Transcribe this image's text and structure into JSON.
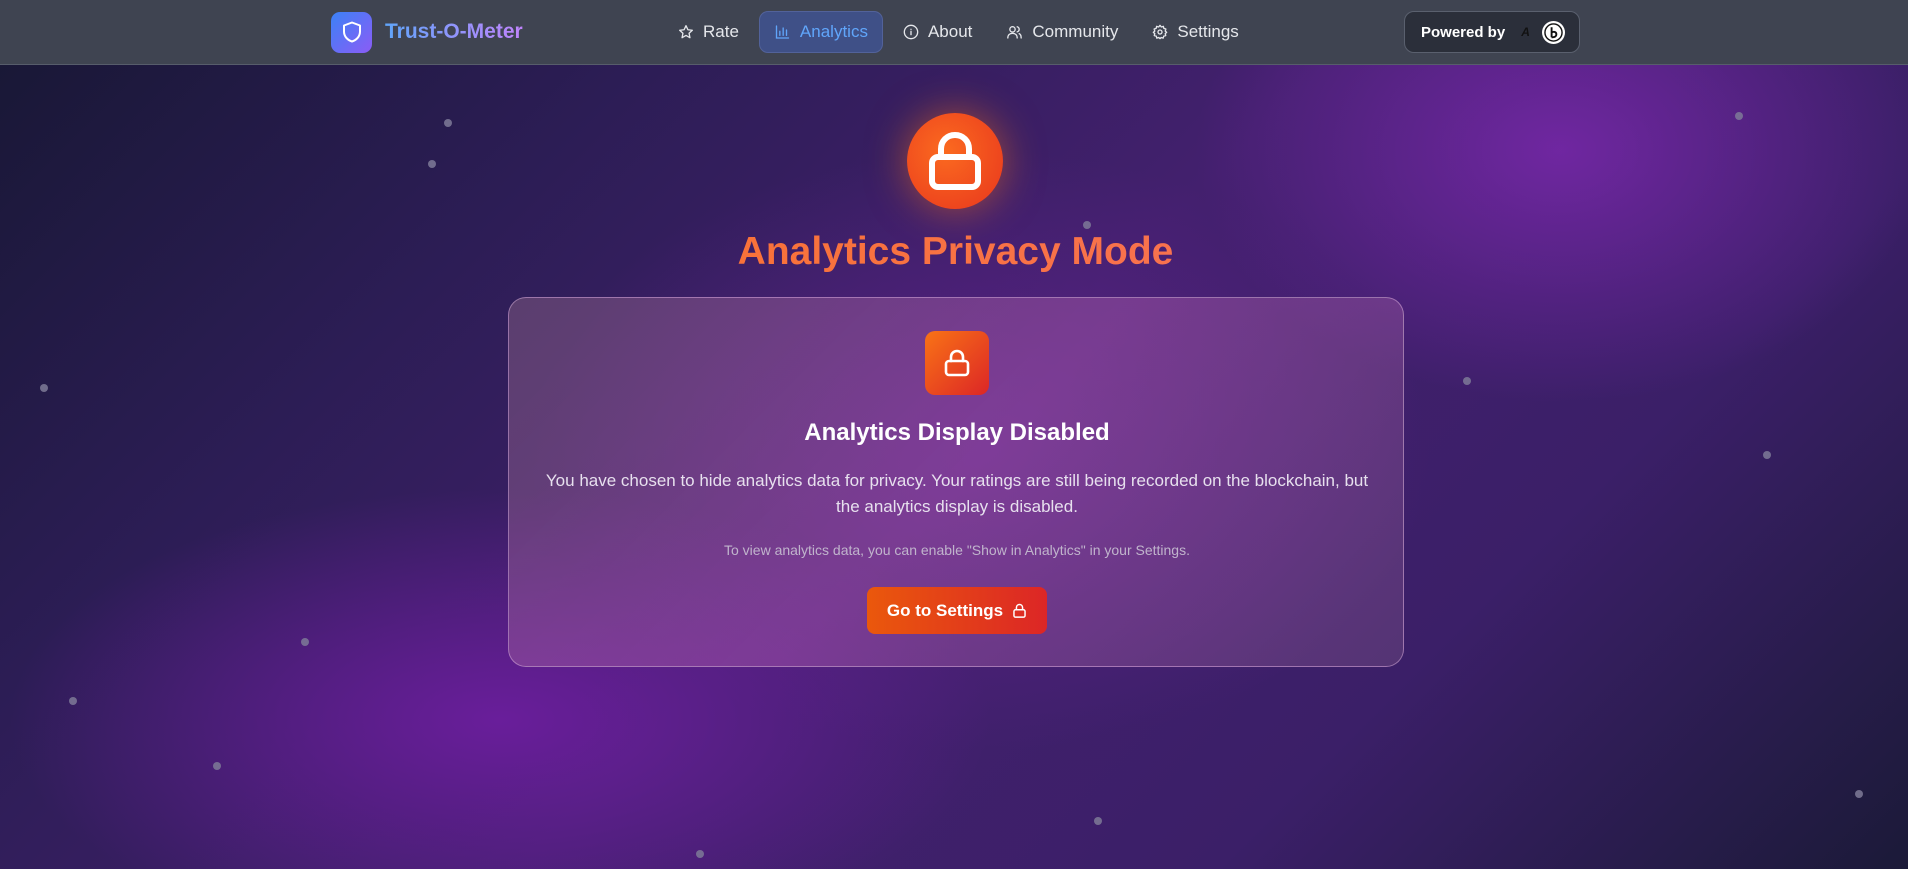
{
  "header": {
    "brand": "Trust-O-Meter",
    "nav": [
      {
        "label": "Rate",
        "icon": "star-icon",
        "active": false
      },
      {
        "label": "Analytics",
        "icon": "bar-chart-icon",
        "active": true
      },
      {
        "label": "About",
        "icon": "info-icon",
        "active": false
      },
      {
        "label": "Community",
        "icon": "users-icon",
        "active": false
      },
      {
        "label": "Settings",
        "icon": "gear-icon",
        "active": false
      }
    ],
    "powered_by": "Powered by"
  },
  "hero": {
    "title": "Analytics Privacy Mode",
    "icon": "lock-icon"
  },
  "card": {
    "title": "Analytics Display Disabled",
    "description": "You have chosen to hide analytics data for privacy. Your ratings are still being recorded on the blockchain, but the analytics display is disabled.",
    "hint": "To view analytics data, you can enable \"Show in Analytics\" in your Settings.",
    "button_label": "Go to Settings"
  },
  "colors": {
    "accent_orange": "#f97316",
    "accent_red": "#dc2626",
    "active_nav": "#60a5fa",
    "navbar_bg": "#3f4451"
  }
}
